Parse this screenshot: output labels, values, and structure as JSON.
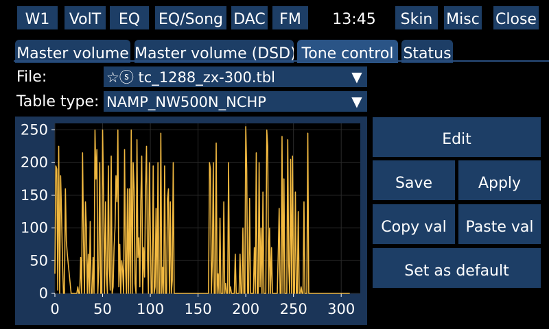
{
  "top_bar": {
    "buttons": [
      "W1",
      "VolT",
      "EQ",
      "EQ/Song",
      "DAC",
      "FM",
      "Skin",
      "Misc",
      "Close"
    ],
    "clock": "13:45"
  },
  "tabs": [
    "Master volume",
    "Master volume (DSD)",
    "Tone control",
    "Status"
  ],
  "active_tab": "Tone control",
  "file": {
    "label": "File:",
    "value": "☆ⓢ tc_1288_zx-300.tbl",
    "arrow": "▼"
  },
  "table_type": {
    "label": "Table type:",
    "value": "NAMP_NW500N_NCHP",
    "arrow": "▼"
  },
  "actions": {
    "edit": "Edit",
    "save": "Save",
    "apply": "Apply",
    "copy_val": "Copy val",
    "paste_val": "Paste val",
    "set_default": "Set as default"
  },
  "colors": {
    "button_bg": "#1d3e66",
    "chart_panel_bg": "#1b3558",
    "plot_bg": "#000000",
    "line": "#f0b840"
  },
  "chart_data": {
    "type": "line",
    "xlim": [
      0,
      320
    ],
    "ylim": [
      0,
      260
    ],
    "x_ticks": [
      0,
      50,
      100,
      150,
      200,
      250,
      300
    ],
    "y_ticks": [
      0,
      50,
      100,
      150,
      200,
      250
    ],
    "grid": true,
    "series": [
      {
        "values": [
          30,
          195,
          190,
          5,
          225,
          0,
          180,
          120,
          45,
          0,
          0,
          160,
          80,
          60,
          45,
          30,
          15,
          0,
          0,
          0,
          0,
          0,
          0,
          0,
          10,
          0,
          0,
          55,
          0,
          215,
          80,
          0,
          140,
          100,
          0,
          60,
          0,
          110,
          0,
          0,
          55,
          0,
          250,
          175,
          220,
          0,
          40,
          200,
          0,
          0,
          250,
          150,
          0,
          140,
          30,
          0,
          195,
          40,
          5,
          210,
          0,
          10,
          70,
          100,
          180,
          140,
          250,
          10,
          75,
          0,
          50,
          35,
          0,
          220,
          40,
          0,
          160,
          0,
          160,
          0,
          250,
          0,
          200,
          160,
          15,
          0,
          235,
          55,
          85,
          10,
          140,
          210,
          0,
          70,
          25,
          160,
          225,
          60,
          0,
          200,
          95,
          0,
          0,
          195,
          0,
          10,
          130,
          0,
          200,
          0,
          0,
          245,
          0,
          40,
          0,
          195,
          0,
          0,
          145,
          160,
          0,
          140,
          0,
          20,
          200,
          0,
          0,
          0,
          0,
          0,
          0,
          0,
          0,
          0,
          0,
          0,
          0,
          0,
          0,
          0,
          0,
          0,
          0,
          0,
          0,
          0,
          0,
          0,
          0,
          0,
          0,
          0,
          0,
          0,
          0,
          0,
          0,
          0,
          0,
          0,
          0,
          0,
          200,
          190,
          0,
          50,
          200,
          0,
          0,
          230,
          0,
          30,
          0,
          115,
          0,
          0,
          0,
          140,
          0,
          15,
          0,
          0,
          200,
          0,
          10,
          0,
          0,
          0,
          0,
          60,
          0,
          0,
          0,
          0,
          60,
          0,
          0,
          100,
          0,
          0,
          255,
          190,
          0,
          0,
          145,
          0,
          0,
          0,
          0,
          70,
          0,
          215,
          0,
          0,
          200,
          10,
          100,
          0,
          155,
          0,
          0,
          0,
          250,
          225,
          0,
          100,
          0,
          70,
          0,
          0,
          0,
          0,
          0,
          0,
          60,
          130,
          0,
          0,
          240,
          0,
          175,
          0,
          0,
          0,
          235,
          45,
          0,
          205,
          0,
          210,
          0,
          0,
          155,
          0,
          0,
          125,
          0,
          0,
          10,
          0,
          0,
          140,
          0,
          0,
          0,
          245,
          0,
          0,
          0,
          0,
          0,
          0,
          0,
          0,
          0,
          0,
          0,
          0,
          0,
          0,
          0,
          0,
          0,
          0,
          0,
          0,
          0,
          0,
          0,
          0,
          0,
          0,
          0,
          0,
          0,
          0,
          0,
          0,
          0,
          0,
          0,
          0,
          0,
          0,
          0,
          0,
          0,
          0,
          0,
          0
        ]
      }
    ]
  }
}
